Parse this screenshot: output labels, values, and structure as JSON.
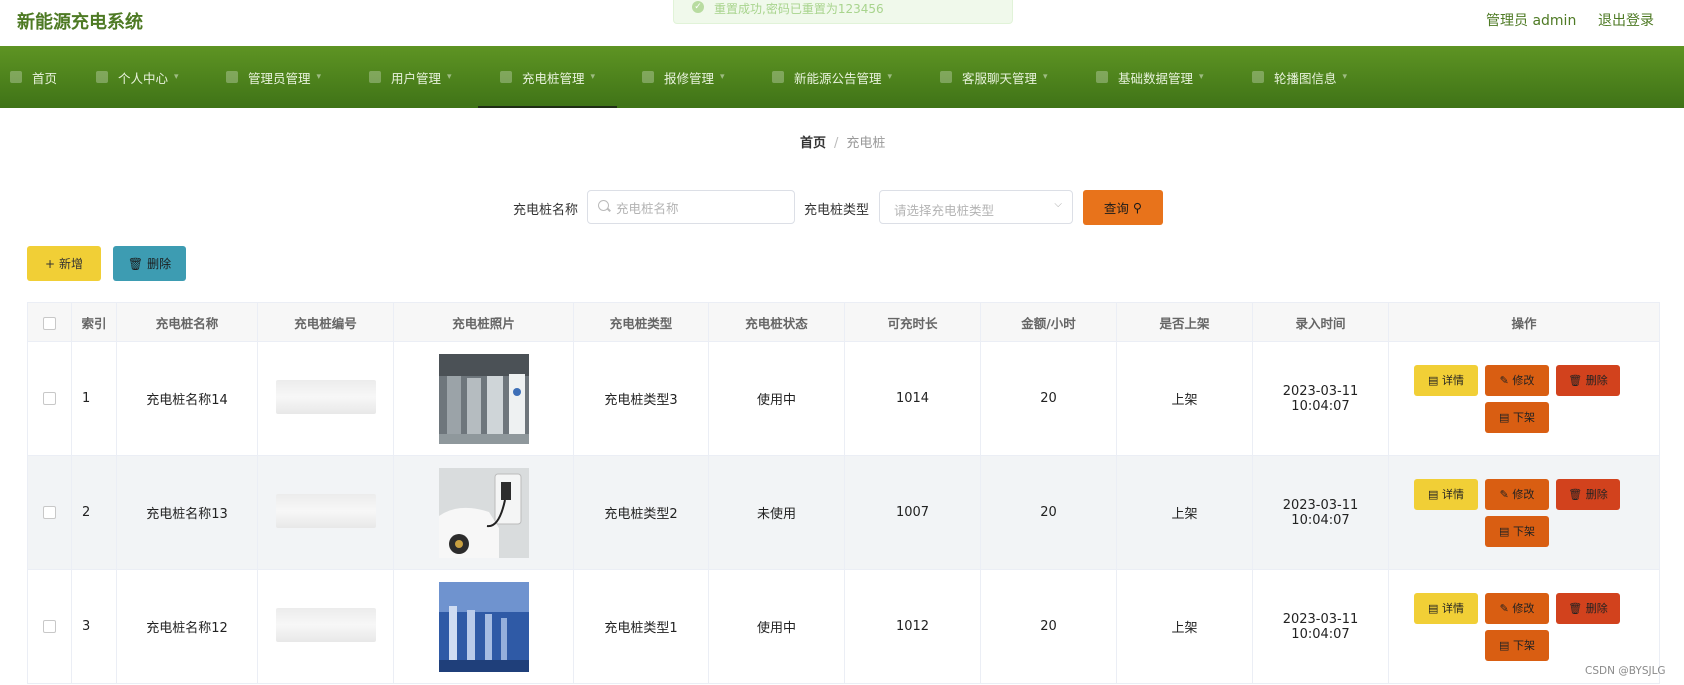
{
  "app": {
    "title": "新能源充电系统"
  },
  "toast": {
    "message": "重置成功,密码已重置为123456"
  },
  "header": {
    "user_label": "管理员 admin",
    "logout_label": "退出登录"
  },
  "nav": {
    "items": [
      {
        "label": "首页"
      },
      {
        "label": "个人中心"
      },
      {
        "label": "管理员管理"
      },
      {
        "label": "用户管理"
      },
      {
        "label": "充电桩管理"
      },
      {
        "label": "报修管理"
      },
      {
        "label": "新能源公告管理"
      },
      {
        "label": "客服聊天管理"
      },
      {
        "label": "基础数据管理"
      },
      {
        "label": "轮播图信息"
      }
    ],
    "active": "充电桩管理"
  },
  "breadcrumb": {
    "home": "首页",
    "current": "充电桩"
  },
  "search": {
    "name_label": "充电桩名称",
    "name_placeholder": "充电桩名称",
    "type_label": "充电桩类型",
    "type_placeholder": "请选择充电桩类型",
    "query_label": "查询"
  },
  "actions": {
    "add_label": "新增",
    "delete_label": "删除"
  },
  "table": {
    "headers": [
      "索引",
      "充电桩名称",
      "充电桩编号",
      "充电桩照片",
      "充电桩类型",
      "充电桩状态",
      "可充时长",
      "金额/小时",
      "是否上架",
      "录入时间",
      "操作"
    ],
    "rows": [
      {
        "index": "1",
        "name": "充电桩名称14",
        "type": "充电桩类型3",
        "status": "使用中",
        "duration": "1014",
        "price": "20",
        "listed": "上架",
        "time": "2023-03-11 10:04:07",
        "photo_icon": "charging-station-photo"
      },
      {
        "index": "2",
        "name": "充电桩名称13",
        "type": "充电桩类型2",
        "status": "未使用",
        "duration": "1007",
        "price": "20",
        "listed": "上架",
        "time": "2023-03-11 10:04:07",
        "photo_icon": "ev-charging-car-photo"
      },
      {
        "index": "3",
        "name": "充电桩名称12",
        "type": "充电桩类型1",
        "status": "使用中",
        "duration": "1012",
        "price": "20",
        "listed": "上架",
        "time": "2023-03-11 10:04:07",
        "photo_icon": "charging-posts-photo"
      }
    ],
    "op_labels": {
      "detail": "详情",
      "edit": "修改",
      "delete": "删除",
      "unlist": "下架"
    }
  },
  "watermark": "CSDN @BYSJLG",
  "colors": {
    "nav_bg": "#4f8420",
    "brand_text": "#4e7a24",
    "query": "#e8731b",
    "add": "#f1cf36",
    "delete": "#3d9cb2"
  }
}
